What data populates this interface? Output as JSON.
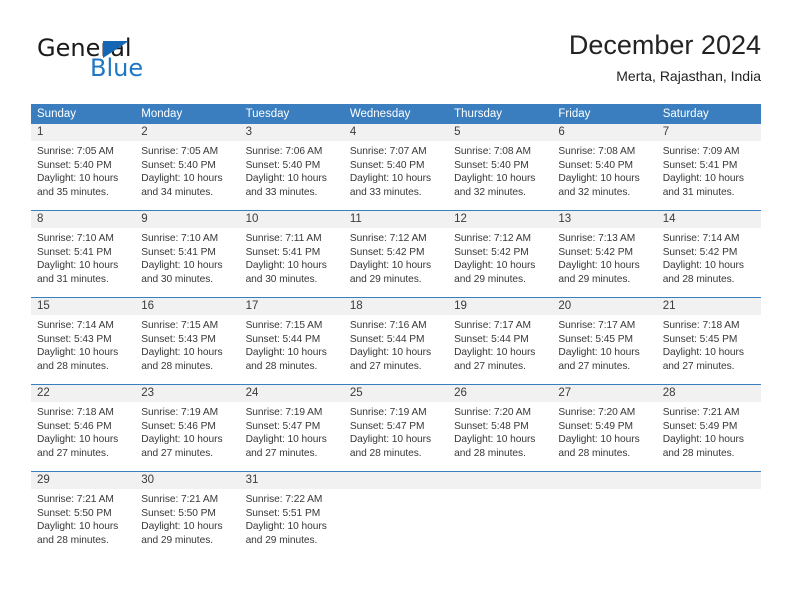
{
  "brand": {
    "name_part1": "General",
    "name_part2": "Blue",
    "triangle_icon": "triangle-icon",
    "accent_color": "#1f77c4"
  },
  "header": {
    "title": "December 2024",
    "subtitle": "Merta, Rajasthan, India"
  },
  "theme": {
    "header_blue": "#3a7ebf",
    "date_strip_gray": "#f1f1f1",
    "text_color": "#383838"
  },
  "calendar": {
    "weekday_headers": [
      "Sunday",
      "Monday",
      "Tuesday",
      "Wednesday",
      "Thursday",
      "Friday",
      "Saturday"
    ],
    "weeks": [
      [
        {
          "date": "1",
          "sunrise": "Sunrise: 7:05 AM",
          "sunset": "Sunset: 5:40 PM",
          "daylight_line1": "Daylight: 10 hours",
          "daylight_line2": "and 35 minutes."
        },
        {
          "date": "2",
          "sunrise": "Sunrise: 7:05 AM",
          "sunset": "Sunset: 5:40 PM",
          "daylight_line1": "Daylight: 10 hours",
          "daylight_line2": "and 34 minutes."
        },
        {
          "date": "3",
          "sunrise": "Sunrise: 7:06 AM",
          "sunset": "Sunset: 5:40 PM",
          "daylight_line1": "Daylight: 10 hours",
          "daylight_line2": "and 33 minutes."
        },
        {
          "date": "4",
          "sunrise": "Sunrise: 7:07 AM",
          "sunset": "Sunset: 5:40 PM",
          "daylight_line1": "Daylight: 10 hours",
          "daylight_line2": "and 33 minutes."
        },
        {
          "date": "5",
          "sunrise": "Sunrise: 7:08 AM",
          "sunset": "Sunset: 5:40 PM",
          "daylight_line1": "Daylight: 10 hours",
          "daylight_line2": "and 32 minutes."
        },
        {
          "date": "6",
          "sunrise": "Sunrise: 7:08 AM",
          "sunset": "Sunset: 5:40 PM",
          "daylight_line1": "Daylight: 10 hours",
          "daylight_line2": "and 32 minutes."
        },
        {
          "date": "7",
          "sunrise": "Sunrise: 7:09 AM",
          "sunset": "Sunset: 5:41 PM",
          "daylight_line1": "Daylight: 10 hours",
          "daylight_line2": "and 31 minutes."
        }
      ],
      [
        {
          "date": "8",
          "sunrise": "Sunrise: 7:10 AM",
          "sunset": "Sunset: 5:41 PM",
          "daylight_line1": "Daylight: 10 hours",
          "daylight_line2": "and 31 minutes."
        },
        {
          "date": "9",
          "sunrise": "Sunrise: 7:10 AM",
          "sunset": "Sunset: 5:41 PM",
          "daylight_line1": "Daylight: 10 hours",
          "daylight_line2": "and 30 minutes."
        },
        {
          "date": "10",
          "sunrise": "Sunrise: 7:11 AM",
          "sunset": "Sunset: 5:41 PM",
          "daylight_line1": "Daylight: 10 hours",
          "daylight_line2": "and 30 minutes."
        },
        {
          "date": "11",
          "sunrise": "Sunrise: 7:12 AM",
          "sunset": "Sunset: 5:42 PM",
          "daylight_line1": "Daylight: 10 hours",
          "daylight_line2": "and 29 minutes."
        },
        {
          "date": "12",
          "sunrise": "Sunrise: 7:12 AM",
          "sunset": "Sunset: 5:42 PM",
          "daylight_line1": "Daylight: 10 hours",
          "daylight_line2": "and 29 minutes."
        },
        {
          "date": "13",
          "sunrise": "Sunrise: 7:13 AM",
          "sunset": "Sunset: 5:42 PM",
          "daylight_line1": "Daylight: 10 hours",
          "daylight_line2": "and 29 minutes."
        },
        {
          "date": "14",
          "sunrise": "Sunrise: 7:14 AM",
          "sunset": "Sunset: 5:42 PM",
          "daylight_line1": "Daylight: 10 hours",
          "daylight_line2": "and 28 minutes."
        }
      ],
      [
        {
          "date": "15",
          "sunrise": "Sunrise: 7:14 AM",
          "sunset": "Sunset: 5:43 PM",
          "daylight_line1": "Daylight: 10 hours",
          "daylight_line2": "and 28 minutes."
        },
        {
          "date": "16",
          "sunrise": "Sunrise: 7:15 AM",
          "sunset": "Sunset: 5:43 PM",
          "daylight_line1": "Daylight: 10 hours",
          "daylight_line2": "and 28 minutes."
        },
        {
          "date": "17",
          "sunrise": "Sunrise: 7:15 AM",
          "sunset": "Sunset: 5:44 PM",
          "daylight_line1": "Daylight: 10 hours",
          "daylight_line2": "and 28 minutes."
        },
        {
          "date": "18",
          "sunrise": "Sunrise: 7:16 AM",
          "sunset": "Sunset: 5:44 PM",
          "daylight_line1": "Daylight: 10 hours",
          "daylight_line2": "and 27 minutes."
        },
        {
          "date": "19",
          "sunrise": "Sunrise: 7:17 AM",
          "sunset": "Sunset: 5:44 PM",
          "daylight_line1": "Daylight: 10 hours",
          "daylight_line2": "and 27 minutes."
        },
        {
          "date": "20",
          "sunrise": "Sunrise: 7:17 AM",
          "sunset": "Sunset: 5:45 PM",
          "daylight_line1": "Daylight: 10 hours",
          "daylight_line2": "and 27 minutes."
        },
        {
          "date": "21",
          "sunrise": "Sunrise: 7:18 AM",
          "sunset": "Sunset: 5:45 PM",
          "daylight_line1": "Daylight: 10 hours",
          "daylight_line2": "and 27 minutes."
        }
      ],
      [
        {
          "date": "22",
          "sunrise": "Sunrise: 7:18 AM",
          "sunset": "Sunset: 5:46 PM",
          "daylight_line1": "Daylight: 10 hours",
          "daylight_line2": "and 27 minutes."
        },
        {
          "date": "23",
          "sunrise": "Sunrise: 7:19 AM",
          "sunset": "Sunset: 5:46 PM",
          "daylight_line1": "Daylight: 10 hours",
          "daylight_line2": "and 27 minutes."
        },
        {
          "date": "24",
          "sunrise": "Sunrise: 7:19 AM",
          "sunset": "Sunset: 5:47 PM",
          "daylight_line1": "Daylight: 10 hours",
          "daylight_line2": "and 27 minutes."
        },
        {
          "date": "25",
          "sunrise": "Sunrise: 7:19 AM",
          "sunset": "Sunset: 5:47 PM",
          "daylight_line1": "Daylight: 10 hours",
          "daylight_line2": "and 28 minutes."
        },
        {
          "date": "26",
          "sunrise": "Sunrise: 7:20 AM",
          "sunset": "Sunset: 5:48 PM",
          "daylight_line1": "Daylight: 10 hours",
          "daylight_line2": "and 28 minutes."
        },
        {
          "date": "27",
          "sunrise": "Sunrise: 7:20 AM",
          "sunset": "Sunset: 5:49 PM",
          "daylight_line1": "Daylight: 10 hours",
          "daylight_line2": "and 28 minutes."
        },
        {
          "date": "28",
          "sunrise": "Sunrise: 7:21 AM",
          "sunset": "Sunset: 5:49 PM",
          "daylight_line1": "Daylight: 10 hours",
          "daylight_line2": "and 28 minutes."
        }
      ],
      [
        {
          "date": "29",
          "sunrise": "Sunrise: 7:21 AM",
          "sunset": "Sunset: 5:50 PM",
          "daylight_line1": "Daylight: 10 hours",
          "daylight_line2": "and 28 minutes."
        },
        {
          "date": "30",
          "sunrise": "Sunrise: 7:21 AM",
          "sunset": "Sunset: 5:50 PM",
          "daylight_line1": "Daylight: 10 hours",
          "daylight_line2": "and 29 minutes."
        },
        {
          "date": "31",
          "sunrise": "Sunrise: 7:22 AM",
          "sunset": "Sunset: 5:51 PM",
          "daylight_line1": "Daylight: 10 hours",
          "daylight_line2": "and 29 minutes."
        },
        {
          "date": "",
          "sunrise": "",
          "sunset": "",
          "daylight_line1": "",
          "daylight_line2": ""
        },
        {
          "date": "",
          "sunrise": "",
          "sunset": "",
          "daylight_line1": "",
          "daylight_line2": ""
        },
        {
          "date": "",
          "sunrise": "",
          "sunset": "",
          "daylight_line1": "",
          "daylight_line2": ""
        },
        {
          "date": "",
          "sunrise": "",
          "sunset": "",
          "daylight_line1": "",
          "daylight_line2": ""
        }
      ]
    ]
  }
}
